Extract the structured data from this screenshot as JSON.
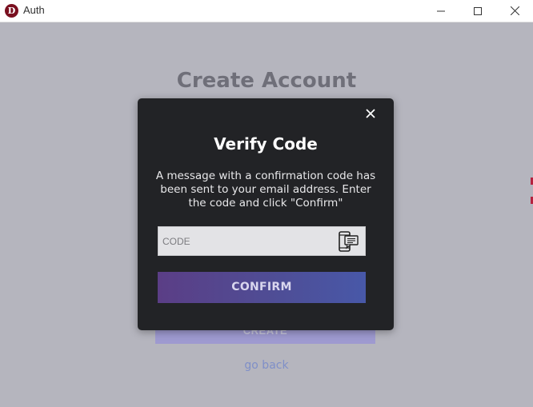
{
  "window": {
    "logo_letter": "D",
    "title": "Auth"
  },
  "background": {
    "title": "Create Account",
    "create_label": "CREATE",
    "go_back_label": "go back"
  },
  "modal": {
    "title": "Verify Code",
    "message": "A message with a confirmation code has been sent to your email address. Enter the code and click \"Confirm\"",
    "code_placeholder": "CODE",
    "code_value": "",
    "confirm_label": "CONFIRM"
  },
  "icons": {
    "close": "close-icon",
    "sms": "phone-message-icon"
  },
  "colors": {
    "overlay_bg": "#b5b5be",
    "modal_bg": "#222326",
    "confirm_gradient_start": "#5b3e86",
    "confirm_gradient_end": "#4858a8",
    "logo_red": "#7a1020"
  }
}
